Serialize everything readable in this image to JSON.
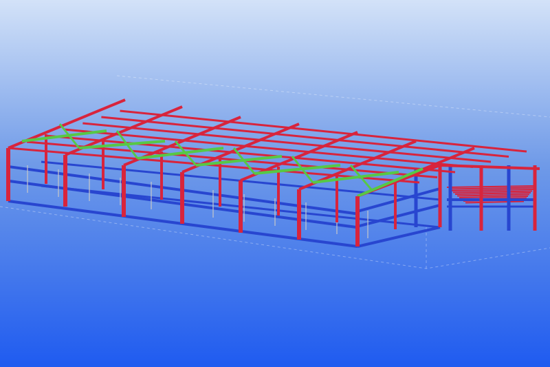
{
  "view": {
    "background_top": "#d3e2f8",
    "background_mid": "#6f9ae8",
    "background_bottom": "#1f5bf0"
  },
  "model": {
    "description_visible": false,
    "member_colors": {
      "column": "#d8243c",
      "rafter": "#d8243c",
      "purlin": "#d8243c",
      "bracing": "#57c846",
      "girt": "#2846d0",
      "ground_beam": "#2846d0",
      "hanger": "#c8c8c8",
      "mezzanine_deck": "#d8243c"
    },
    "member_groups": [
      "columns-front",
      "columns-back",
      "rafters",
      "purlins",
      "roof-bracing",
      "wall-girts",
      "ground-beams",
      "hangers",
      "mezzanine"
    ]
  }
}
